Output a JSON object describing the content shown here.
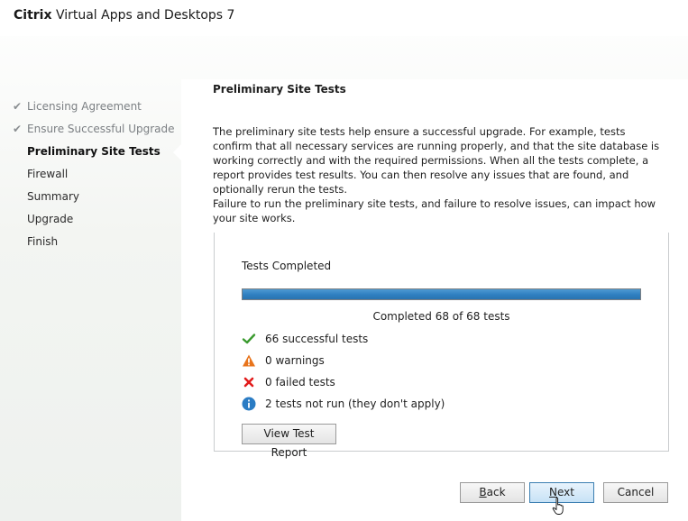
{
  "window": {
    "brand": "Citrix",
    "product": "Virtual Apps and Desktops 7"
  },
  "sidebar": {
    "steps": [
      {
        "label": "Licensing Agreement",
        "state": "done"
      },
      {
        "label": "Ensure Successful Upgrade",
        "state": "done"
      },
      {
        "label": "Preliminary Site Tests",
        "state": "active"
      },
      {
        "label": "Firewall",
        "state": "pending"
      },
      {
        "label": "Summary",
        "state": "pending"
      },
      {
        "label": "Upgrade",
        "state": "pending"
      },
      {
        "label": "Finish",
        "state": "pending"
      }
    ]
  },
  "main": {
    "title": "Preliminary Site Tests",
    "description_1": "The preliminary site tests help ensure a successful upgrade. For example, tests confirm that all necessary services are running properly, and that the site database is working correctly and with the required permissions. When all the tests complete, a report provides test results. You can then resolve any issues that are found, and optionally rerun the tests.",
    "description_2": "Failure to run the preliminary site tests, and failure to resolve issues, can impact how your site works.",
    "results": {
      "heading": "Tests Completed",
      "progress_fraction": 1.0,
      "progress_text": "Completed 68 of 68 tests",
      "stats": [
        {
          "icon": "checkmark-icon",
          "label": "66 successful tests"
        },
        {
          "icon": "warning-icon",
          "label": "0 warnings"
        },
        {
          "icon": "error-x-icon",
          "label": "0 failed tests"
        },
        {
          "icon": "info-icon",
          "label": "2 tests not run (they don't apply)"
        }
      ],
      "report_button": "View Test Report"
    }
  },
  "footer": {
    "back_prefix": "",
    "back_accel": "B",
    "back_rest": "ack",
    "next_prefix": "",
    "next_accel": "N",
    "next_rest": "ext",
    "cancel": "Cancel"
  },
  "colors": {
    "progress": "#2f7fc0",
    "success": "#3a9a2e",
    "warning": "#e8741c",
    "error": "#e21b1b",
    "info": "#2a7cc4",
    "next_border": "#3c7fb1"
  }
}
